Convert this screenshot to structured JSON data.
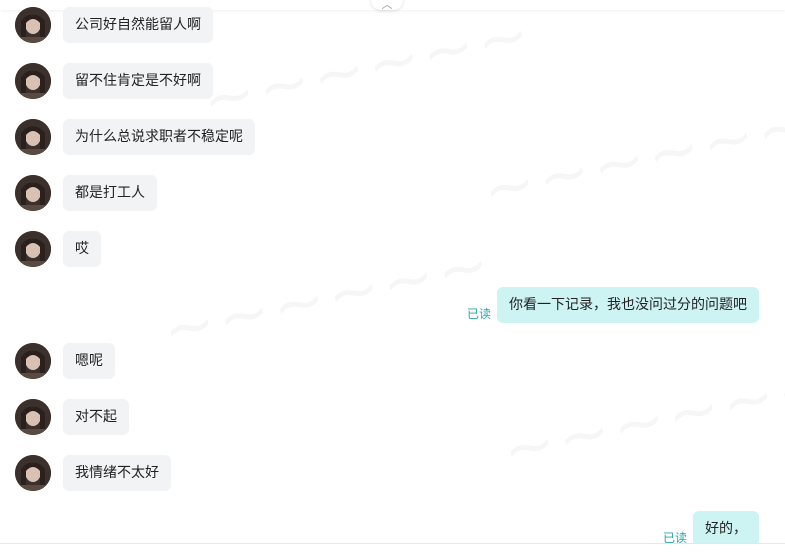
{
  "messages": [
    {
      "side": "in",
      "text": "公司好自然能留人啊"
    },
    {
      "side": "in",
      "text": "留不住肯定是不好啊"
    },
    {
      "side": "in",
      "text": "为什么总说求职者不稳定呢"
    },
    {
      "side": "in",
      "text": "都是打工人"
    },
    {
      "side": "in",
      "text": "哎"
    },
    {
      "side": "out",
      "text": "你看一下记录，我也没问过分的问题吧",
      "status": "已读"
    },
    {
      "side": "in",
      "text": "嗯呢"
    },
    {
      "side": "in",
      "text": "对不起"
    },
    {
      "side": "in",
      "text": "我情绪不太好"
    },
    {
      "side": "out",
      "text": "好的，",
      "status": "已读"
    }
  ],
  "colors": {
    "incoming_bubble": "#f2f3f5",
    "outgoing_bubble": "#cdf3f3",
    "read_status": "#2da3a8"
  },
  "icons": {
    "collapse": "chevron-up-icon",
    "avatar": "contact-avatar"
  }
}
